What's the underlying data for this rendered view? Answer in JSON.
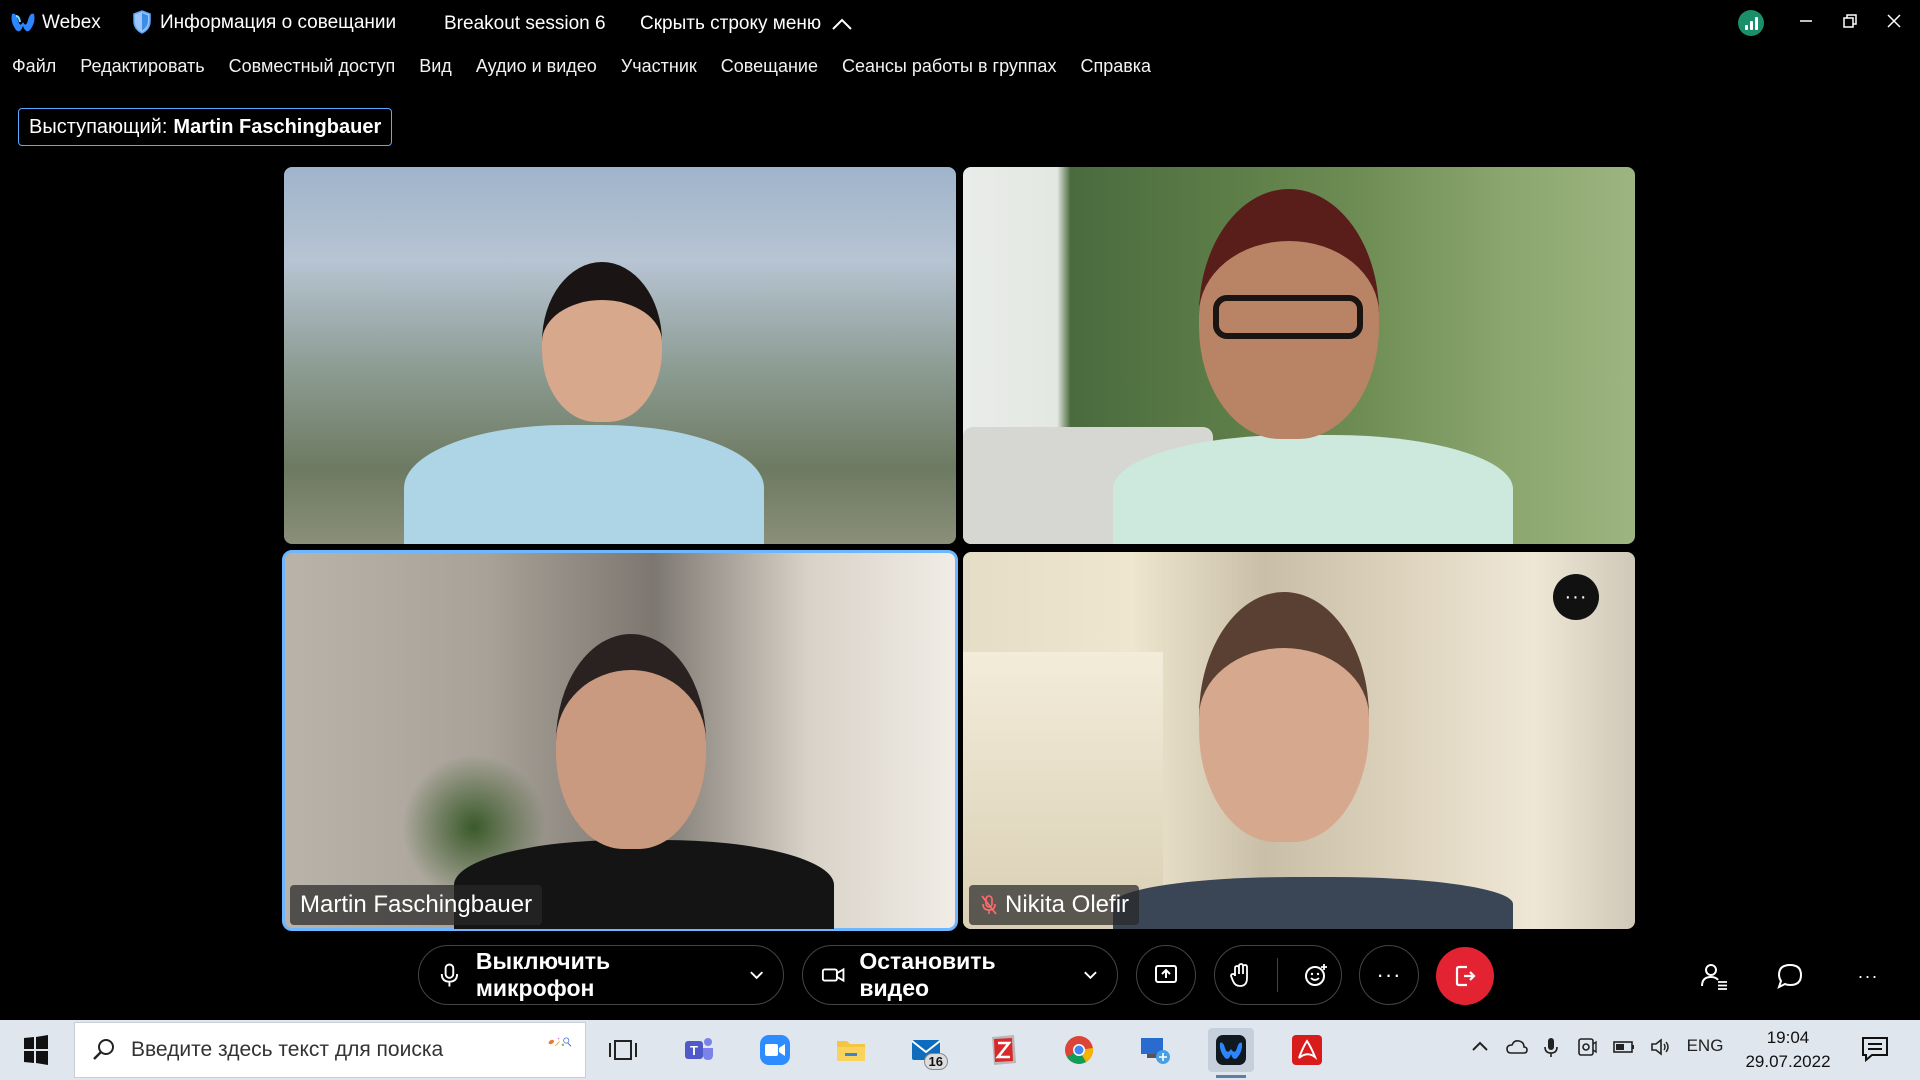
{
  "titlebar": {
    "app_name": "Webex",
    "meeting_info": "Информация о совещании",
    "session": "Breakout session 6",
    "hide_menu": "Скрыть строку меню"
  },
  "menu": {
    "items": [
      "Файл",
      "Редактировать",
      "Совместный доступ",
      "Вид",
      "Аудио и видео",
      "Участник",
      "Совещание",
      "Сеансы работы в группах",
      "Справка"
    ]
  },
  "speaker": {
    "label": "Выступающий:",
    "name": "Martin Faschingbauer"
  },
  "tiles": {
    "bottom_left_name": "Martin Faschingbauer",
    "bottom_right_name": "Nikita Olefir",
    "more_label": "···"
  },
  "controls": {
    "mute_label": "Выключить микрофон",
    "video_label": "Остановить видео",
    "more_label": "···",
    "side_more_label": "···"
  },
  "taskbar": {
    "search_placeholder": "Введите здесь текст для поиска",
    "mail_badge": "16",
    "language": "ENG",
    "time": "19:04",
    "date": "29.07.2022"
  },
  "colors": {
    "accent_border": "#5aa8ff",
    "end_call": "#e32232",
    "status_green": "#1b8f6a",
    "taskbar_bg": "#dfe6ee"
  }
}
